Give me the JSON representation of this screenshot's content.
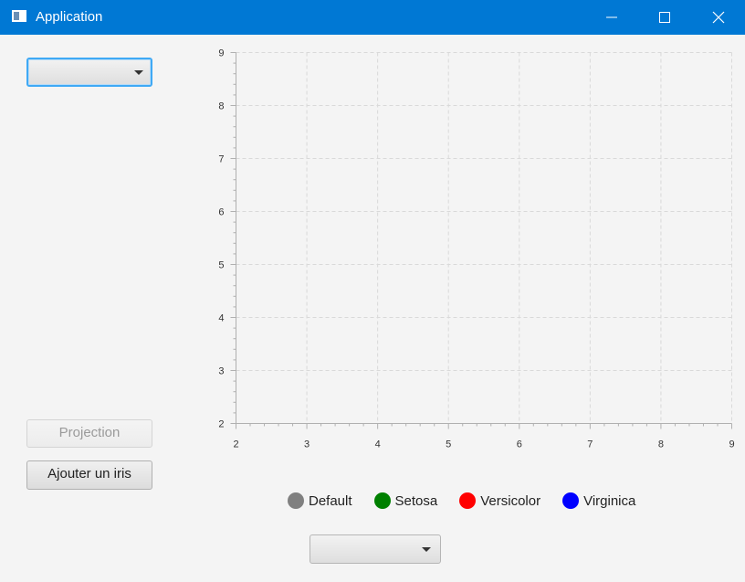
{
  "window": {
    "title": "Application",
    "titlebar_color": "#0078d4",
    "controls": [
      "minimize-icon",
      "maximize-icon",
      "close-icon"
    ]
  },
  "left_panel": {
    "combo_top": {
      "value": ""
    },
    "projection_button": {
      "label": "Projection",
      "enabled": false
    },
    "add_iris_button": {
      "label": "Ajouter un iris"
    }
  },
  "bottom": {
    "combo_bottom": {
      "value": ""
    }
  },
  "legend": [
    {
      "label": "Default",
      "color": "#808080"
    },
    {
      "label": "Setosa",
      "color": "#008000"
    },
    {
      "label": "Versicolor",
      "color": "#ff0000"
    },
    {
      "label": "Virginica",
      "color": "#0000ff"
    }
  ],
  "chart_data": {
    "type": "scatter",
    "series": [],
    "xlim": [
      2,
      9
    ],
    "ylim": [
      2,
      9
    ],
    "x_ticks": [
      "2",
      "3",
      "4",
      "5",
      "6",
      "7",
      "8",
      "9"
    ],
    "y_ticks": [
      "2",
      "3",
      "4",
      "5",
      "6",
      "7",
      "8",
      "9"
    ],
    "minor_ticks_per_unit": 5,
    "grid": true,
    "legend_position": "bottom"
  }
}
